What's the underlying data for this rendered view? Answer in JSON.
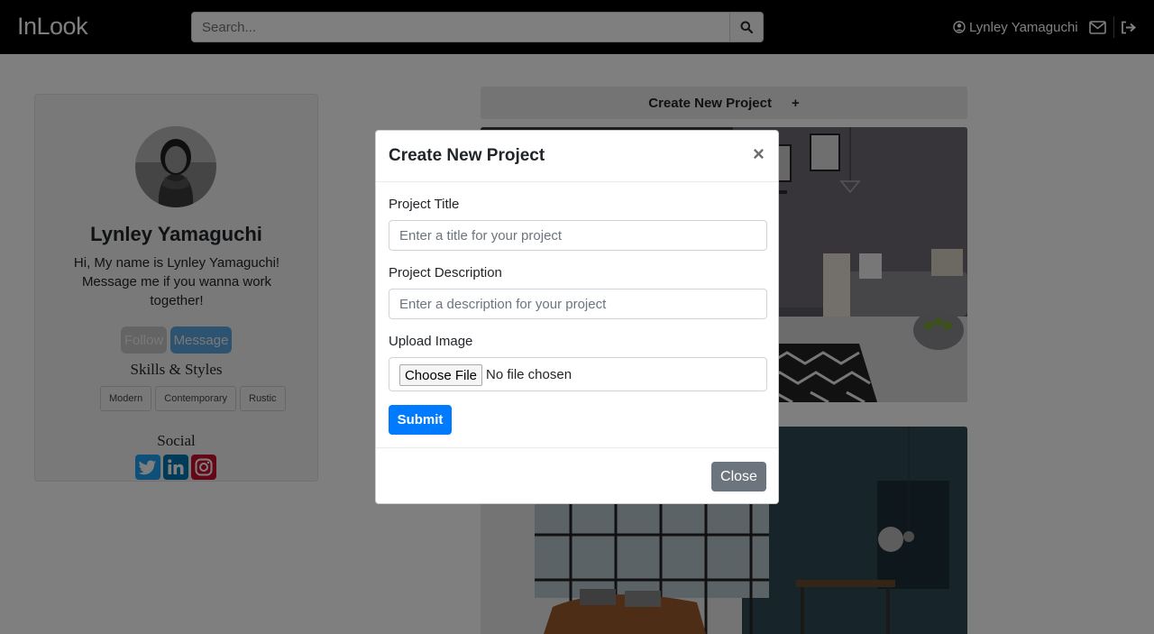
{
  "navbar": {
    "brand": "InLook",
    "search_placeholder": "Search...",
    "user_name": "Lynley Yamaguchi"
  },
  "profile": {
    "name": "Lynley Yamaguchi",
    "bio": "Hi, My name is Lynley Yamaguchi! Message me if you wanna work together!",
    "follow_label": "Follow",
    "message_label": "Message",
    "skills_title": "Skills & Styles",
    "tags": [
      "Modern",
      "Contemporary",
      "Rustic"
    ],
    "social_title": "Social"
  },
  "main": {
    "create_label": "Create New Project",
    "create_plus": "+"
  },
  "modal": {
    "title": "Create New Project",
    "close_x": "×",
    "title_label": "Project Title",
    "title_placeholder": "Enter a title for your project",
    "desc_label": "Project Description",
    "desc_placeholder": "Enter a description for your project",
    "image_label": "Upload Image",
    "choose_file": "Choose File",
    "no_file": "No file chosen",
    "submit_label": "Submit",
    "close_label": "Close"
  },
  "colors": {
    "primary": "#007bff",
    "secondary": "#6c757d",
    "twitter": "#1da1f2",
    "linkedin": "#0077b5",
    "instagram": "#c13584"
  }
}
